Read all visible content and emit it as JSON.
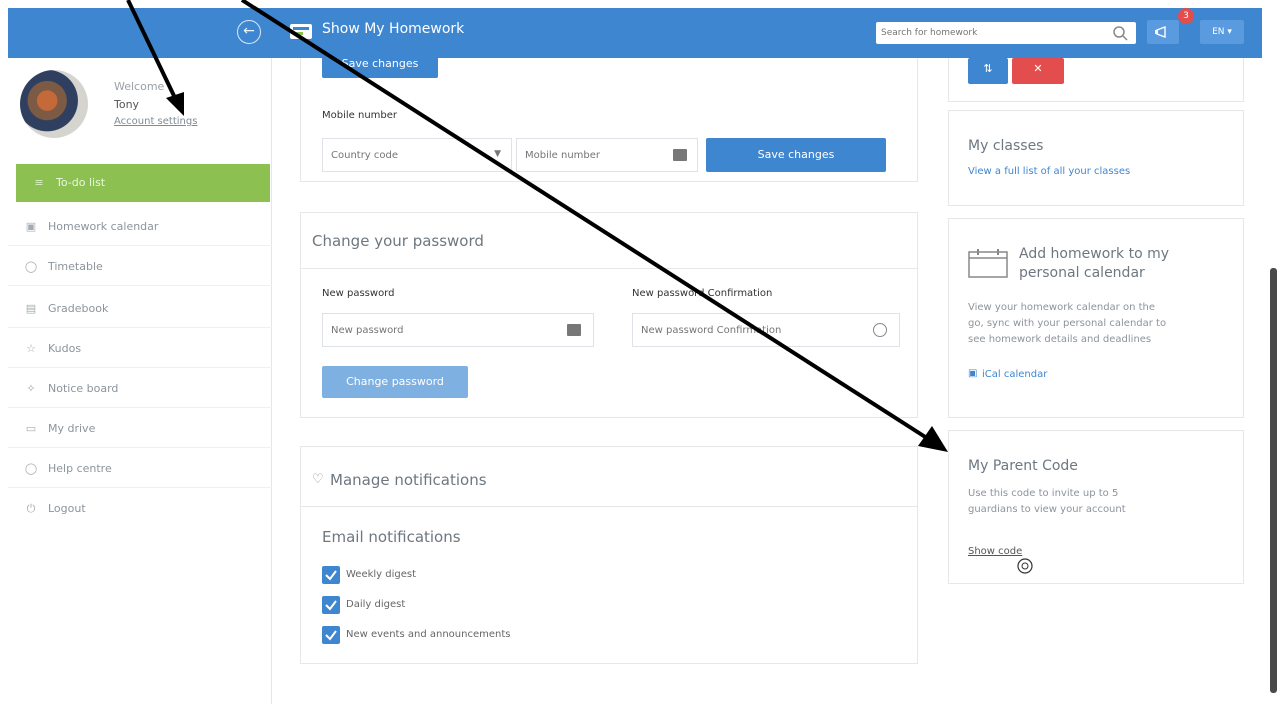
{
  "header": {
    "app_title": "Show My Homework",
    "search_placeholder": "Search for homework",
    "notifications_count": "3",
    "language": "EN ▾"
  },
  "user": {
    "welcome": "Welcome",
    "name": "Tony",
    "account_settings": "Account settings"
  },
  "sidebar": {
    "items": [
      {
        "label": "To-do list",
        "icon": "list-icon"
      },
      {
        "label": "Homework calendar",
        "icon": "calendar-icon"
      },
      {
        "label": "Timetable",
        "icon": "clock-icon"
      },
      {
        "label": "Gradebook",
        "icon": "book-icon"
      },
      {
        "label": "Kudos",
        "icon": "star-icon"
      },
      {
        "label": "Notice board",
        "icon": "pin-icon"
      },
      {
        "label": "My drive",
        "icon": "drive-icon"
      },
      {
        "label": "Help centre",
        "icon": "help-icon"
      },
      {
        "label": "Logout",
        "icon": "power-icon"
      }
    ]
  },
  "mobile": {
    "top_save_label": "Save changes",
    "label": "Mobile number",
    "country_code_placeholder": "Country code",
    "mobile_placeholder": "Mobile number",
    "save_label": "Save changes"
  },
  "password": {
    "title": "Change your password",
    "new_label": "New password",
    "new_placeholder": "New password",
    "confirm_label": "New password Confirmation",
    "confirm_placeholder": "New password Confirmation",
    "button_label": "Change password"
  },
  "notifications": {
    "title": "Manage notifications",
    "email_title": "Email notifications",
    "options": [
      {
        "label": "Weekly digest",
        "checked": true
      },
      {
        "label": "Daily digest",
        "checked": true
      },
      {
        "label": "New events and announcements",
        "checked": true
      }
    ]
  },
  "right": {
    "classes_title": "My classes",
    "classes_link": "View a full list of all your classes",
    "calendar_title_1": "Add homework to my",
    "calendar_title_2": "personal calendar",
    "calendar_text_1": "View your homework calendar on the",
    "calendar_text_2": "go, sync with your personal calendar to",
    "calendar_text_3": "see homework details and deadlines",
    "ical_link": "iCal calendar",
    "parent_title": "My Parent Code",
    "parent_text_1": "Use this code to invite up to 5",
    "parent_text_2": "guardians to view your account",
    "show_code": "Show code"
  },
  "colors": {
    "primary": "#3f86d1",
    "active_nav": "#8cc152",
    "danger": "#e44d4d"
  }
}
